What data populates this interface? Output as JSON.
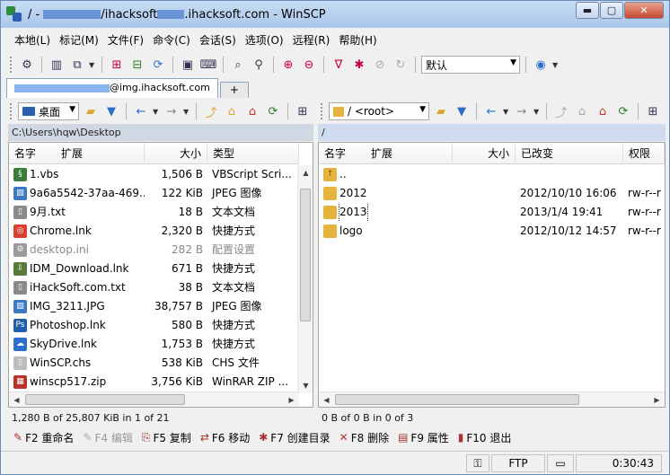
{
  "titlebar": {
    "title_prefix": "/ - ",
    "title_host_mid": "/ihacksoft",
    "title_suffix": ".ihacksoft.com - WinSCP",
    "controls": {
      "minimize": "▬",
      "maximize": "▢",
      "close": "✕"
    }
  },
  "menu": [
    "本地(L)",
    "标记(M)",
    "文件(F)",
    "命令(C)",
    "会话(S)",
    "选项(O)",
    "远程(R)",
    "帮助(H)"
  ],
  "toolbar": {
    "transfer_profile": "默认"
  },
  "tabs": {
    "session_label_suffix": "@img.ihacksoft.com",
    "add_label": "+"
  },
  "left": {
    "drive_label": "桌面",
    "path": "C:\\Users\\hqw\\Desktop",
    "columns": {
      "name": "名字",
      "ext": "扩展",
      "size": "大小",
      "type": "类型"
    },
    "files": [
      {
        "name": "1.vbs",
        "size": "1,506 B",
        "type": "VBScript Scri...",
        "icon": "script-icon",
        "color": "#3a7d3a"
      },
      {
        "name": "9a6a5542-37aa-469...",
        "size": "122 KiB",
        "type": "JPEG 图像",
        "icon": "image-icon",
        "color": "#3b79c4"
      },
      {
        "name": "9月.txt",
        "size": "18 B",
        "type": "文本文档",
        "icon": "text-file-icon",
        "color": "#8a8a8a"
      },
      {
        "name": "Chrome.lnk",
        "size": "2,320 B",
        "type": "快捷方式",
        "icon": "chrome-icon",
        "color": "#d9412e"
      },
      {
        "name": "desktop.ini",
        "size": "282 B",
        "type": "配置设置",
        "icon": "settings-file-icon",
        "color": "#9a9a9a",
        "dim": true
      },
      {
        "name": "IDM_Download.lnk",
        "size": "671 B",
        "type": "快捷方式",
        "icon": "download-icon",
        "color": "#5a7a3a"
      },
      {
        "name": "iHackSoft.com.txt",
        "size": "38 B",
        "type": "文本文档",
        "icon": "text-file-icon",
        "color": "#8a8a8a"
      },
      {
        "name": "IMG_3211.JPG",
        "size": "38,757 B",
        "type": "JPEG 图像",
        "icon": "image-icon",
        "color": "#3b79c4"
      },
      {
        "name": "Photoshop.lnk",
        "size": "580 B",
        "type": "快捷方式",
        "icon": "photoshop-icon",
        "color": "#1f5fa8"
      },
      {
        "name": "SkyDrive.lnk",
        "size": "1,753 B",
        "type": "快捷方式",
        "icon": "cloud-icon",
        "color": "#2a6fc9"
      },
      {
        "name": "WinSCP.chs",
        "size": "538 KiB",
        "type": "CHS 文件",
        "icon": "blank-file-icon",
        "color": "#bdbdbd"
      },
      {
        "name": "winscp517.zip",
        "size": "3,756 KiB",
        "type": "WinRAR ZIP ...",
        "icon": "archive-icon",
        "color": "#b8322a"
      }
    ],
    "status": "1,280 B of 25,807 KiB in 1 of 21"
  },
  "right": {
    "root_label": "/ <root>",
    "path": "/",
    "columns": {
      "name": "名字",
      "ext": "扩展",
      "size": "大小",
      "modified": "已改变",
      "rights": "权限"
    },
    "files": [
      {
        "name": "..",
        "modified": "",
        "rights": "",
        "icon": "parent-dir-icon",
        "color": "#e5b43c"
      },
      {
        "name": "2012",
        "modified": "2012/10/10 16:06",
        "rights": "rw-r--r",
        "icon": "folder-icon",
        "color": "#e5b43c"
      },
      {
        "name": "2013",
        "modified": "2013/1/4 19:41",
        "rights": "rw-r--r",
        "icon": "folder-icon",
        "color": "#e5b43c"
      },
      {
        "name": "logo",
        "modified": "2012/10/12 14:57",
        "rights": "rw-r--r",
        "icon": "folder-icon",
        "color": "#e5b43c"
      }
    ],
    "status": "0 B of 0 B in 0 of 3"
  },
  "fkeys": [
    {
      "label": "F2 重命名",
      "icon": "rename-icon",
      "glyph": "✎",
      "enabled": true
    },
    {
      "label": "F4 编辑",
      "icon": "edit-icon",
      "glyph": "✎",
      "enabled": false
    },
    {
      "label": "F5 复制",
      "icon": "copy-icon",
      "glyph": "⎘",
      "enabled": true
    },
    {
      "label": "F6 移动",
      "icon": "move-icon",
      "glyph": "⇄",
      "enabled": true
    },
    {
      "label": "F7 创建目录",
      "icon": "new-folder-icon",
      "glyph": "✱",
      "enabled": true
    },
    {
      "label": "F8 删除",
      "icon": "delete-icon",
      "glyph": "✕",
      "enabled": true
    },
    {
      "label": "F9 属性",
      "icon": "properties-icon",
      "glyph": "▤",
      "enabled": true
    },
    {
      "label": "F10 退出",
      "icon": "exit-icon",
      "glyph": "▮",
      "enabled": true
    }
  ],
  "statusbar": {
    "protocol": "FTP",
    "elapsed": "0:30:43"
  },
  "colors": {
    "accent": "#3b79c4",
    "title_gradient_top": "#c7dcf5",
    "close_red": "#c7482e"
  }
}
